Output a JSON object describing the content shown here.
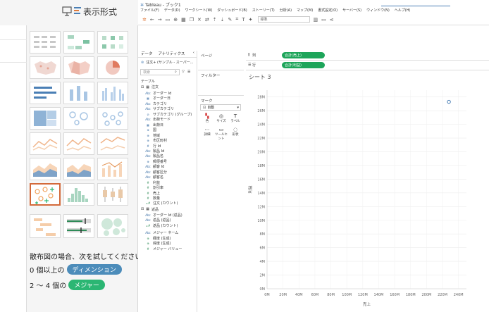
{
  "showme": {
    "label": "表示形式",
    "hint": "散布図の場合、次を試してください。",
    "req1_prefix": "0 個以上の",
    "req1_pill": "ディメンション",
    "req2_prefix": "2 ～ 4 個の",
    "req2_pill": "メジャー",
    "colors": {
      "dimension": "#4c8cba",
      "measure": "#2bb673",
      "selected_border": "#d36a3a"
    }
  },
  "window": {
    "title": "Tableau - ブック1",
    "menu": [
      "ファイル(F)",
      "データ(D)",
      "ワークシート(W)",
      "ダッシュボード(B)",
      "ストーリー(T)",
      "分析(A)",
      "マップ(M)",
      "書式設定(O)",
      "サーバー(S)",
      "ウィンドウ(N)",
      "ヘルプ(H)"
    ],
    "toolbar_mode": "標準"
  },
  "data_panel": {
    "tab_data": "データ",
    "tab_analytics": "アナリティクス",
    "source": "注文+ (サンプル - スーパー...",
    "search_placeholder": "検索",
    "section_table": "テーブル",
    "group_orders": "注文",
    "order_fields": [
      {
        "icon": "Abc",
        "name": "オーダー Id",
        "kind": "dim"
      },
      {
        "icon": "▦",
        "name": "オーダー日",
        "kind": "dim"
      },
      {
        "icon": "Abc",
        "name": "カテゴリ",
        "kind": "dim"
      },
      {
        "icon": "Abc",
        "name": "サブカテゴリ",
        "kind": "dim"
      },
      {
        "icon": "⊘",
        "name": "サブカテゴリ (グループ)",
        "kind": "dim"
      },
      {
        "icon": "Abc",
        "name": "出荷モード",
        "kind": "dim"
      },
      {
        "icon": "▦",
        "name": "出荷日",
        "kind": "dim"
      },
      {
        "icon": "⊕",
        "name": "国",
        "kind": "dim"
      },
      {
        "icon": "⊕",
        "name": "地域",
        "kind": "dim"
      },
      {
        "icon": "⊕",
        "name": "市区町村",
        "kind": "dim"
      },
      {
        "icon": "#",
        "name": "行 Id",
        "kind": "dim"
      },
      {
        "icon": "Abc",
        "name": "製品 Id",
        "kind": "dim"
      },
      {
        "icon": "Abc",
        "name": "製品名",
        "kind": "dim"
      },
      {
        "icon": "⊕",
        "name": "郵便番号",
        "kind": "dim"
      },
      {
        "icon": "Abc",
        "name": "顧客 Id",
        "kind": "dim"
      },
      {
        "icon": "Abc",
        "name": "顧客区分",
        "kind": "dim"
      },
      {
        "icon": "Abc",
        "name": "顧客名",
        "kind": "dim"
      },
      {
        "icon": "#",
        "name": "利益",
        "kind": "mea"
      },
      {
        "icon": "#",
        "name": "割引率",
        "kind": "mea"
      },
      {
        "icon": "#",
        "name": "売上",
        "kind": "mea"
      },
      {
        "icon": "#",
        "name": "数量",
        "kind": "mea"
      },
      {
        "icon": "=#",
        "name": "注文 (カウント)",
        "kind": "mea"
      }
    ],
    "group_returns": "返品",
    "return_fields": [
      {
        "icon": "Abc",
        "name": "オーダー Id (返品)",
        "kind": "dim"
      },
      {
        "icon": "Abc",
        "name": "返品 (返品)",
        "kind": "dim"
      },
      {
        "icon": "=#",
        "name": "返品 (カウント)",
        "kind": "mea"
      }
    ],
    "extra_fields": [
      {
        "icon": "Abc",
        "name": "メジャー ネーム",
        "kind": "dim"
      },
      {
        "icon": "⊕",
        "name": "経度 (生成)",
        "kind": "mea"
      },
      {
        "icon": "⊕",
        "name": "緯度 (生成)",
        "kind": "mea"
      },
      {
        "icon": "#",
        "name": "メジャー バリュー",
        "kind": "mea"
      }
    ]
  },
  "cards": {
    "pages": "ページ",
    "filters": "フィルター",
    "marks": "マーク",
    "mark_type": "自動",
    "mark_buttons": [
      "色",
      "サイズ",
      "ラベル",
      "詳細",
      "ツールヒント",
      "形状"
    ]
  },
  "shelves": {
    "columns_label": "列",
    "columns_pill": "合計(売上)",
    "rows_label": "行",
    "rows_pill": "合計(利益)"
  },
  "sheet": {
    "title": "シート 3",
    "chart_data": {
      "type": "scatter",
      "title": "",
      "xlabel": "売上",
      "ylabel": "利益",
      "x_ticks": [
        "0M",
        "20M",
        "40M",
        "60M",
        "80M",
        "100M",
        "120M",
        "140M",
        "160M",
        "180M",
        "200M",
        "220M",
        "240M"
      ],
      "y_ticks": [
        "0M",
        "2M",
        "4M",
        "6M",
        "8M",
        "10M",
        "12M",
        "14M",
        "16M",
        "18M",
        "20M",
        "22M",
        "24M",
        "26M",
        "28M"
      ],
      "xlim": [
        0,
        250
      ],
      "ylim": [
        0,
        29
      ],
      "grid": true,
      "points": [
        {
          "x": 228,
          "y": 27.3
        }
      ],
      "point_color": "#4a7fb5"
    }
  }
}
